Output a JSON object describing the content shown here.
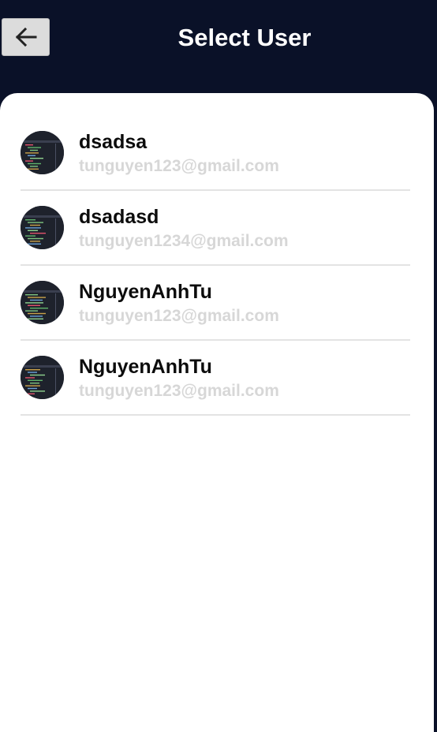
{
  "header": {
    "title": "Select User",
    "back_icon": "arrow-left-icon"
  },
  "users": [
    {
      "name": "dsadsa",
      "email": "tunguyen123@gmail.com",
      "avatar_icon": "code-editor-thumbnail"
    },
    {
      "name": "dsadasd",
      "email": "tunguyen1234@gmail.com",
      "avatar_icon": "code-editor-thumbnail"
    },
    {
      "name": "NguyenAnhTu",
      "email": "tunguyen123@gmail.com",
      "avatar_icon": "code-editor-thumbnail"
    },
    {
      "name": "NguyenAnhTu",
      "email": "tunguyen123@gmail.com",
      "avatar_icon": "code-editor-thumbnail"
    }
  ],
  "colors": {
    "header_bg": "#0a1128",
    "panel_bg": "#ffffff",
    "email_text": "#d7d7d7",
    "divider": "#e3e3e3"
  }
}
